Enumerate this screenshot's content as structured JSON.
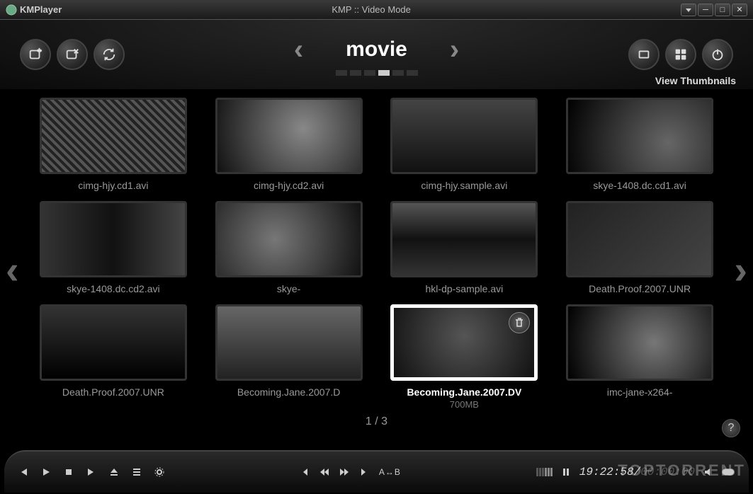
{
  "titlebar": {
    "app_name": "KMPlayer",
    "window_title": "KMP :: Video Mode"
  },
  "toolbar": {
    "folder_name": "movie",
    "view_label": "View Thumbnails",
    "page_dots": {
      "count": 6,
      "active": 3
    }
  },
  "grid": {
    "items": [
      {
        "label": "cimg-hjy.cd1.avi",
        "variant": 1
      },
      {
        "label": "cimg-hjy.cd2.avi",
        "variant": 2
      },
      {
        "label": "cimg-hjy.sample.avi",
        "variant": 3
      },
      {
        "label": "skye-1408.dc.cd1.avi",
        "variant": 4
      },
      {
        "label": "skye-1408.dc.cd2.avi",
        "variant": 5
      },
      {
        "label": "skye-",
        "variant": 6
      },
      {
        "label": "hkl-dp-sample.avi",
        "variant": 7
      },
      {
        "label": "Death.Proof.2007.UNR",
        "variant": 8
      },
      {
        "label": "Death.Proof.2007.UNR",
        "variant": 9
      },
      {
        "label": "Becoming.Jane.2007.D",
        "variant": 10
      },
      {
        "label": "Becoming.Jane.2007.DV",
        "variant": 11,
        "selected": true,
        "sublabel": "700MB"
      },
      {
        "label": "imc-jane-x264-",
        "variant": 12
      }
    ],
    "page_indicator": "1 / 3"
  },
  "help": "?",
  "playback": {
    "ab_label": "A↔B",
    "time_current": "19:22:58",
    "time_total": "00:00:00"
  },
  "watermark": "TOPTORRENT"
}
